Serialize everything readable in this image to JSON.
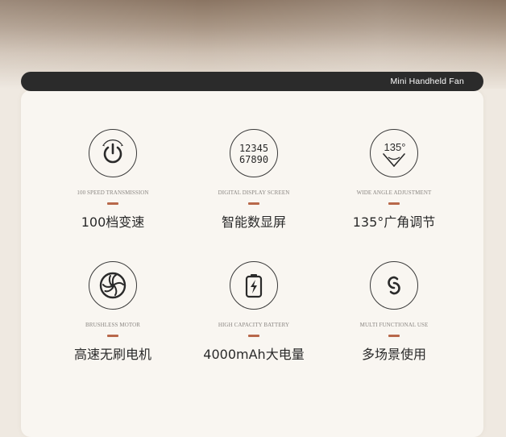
{
  "header": {
    "title": "Mini Handheld Fan"
  },
  "colors": {
    "header_bg": "#2b2b2b",
    "accent": "#b8684a",
    "card_bg": "#f9f6f1"
  },
  "features": [
    {
      "icon": "power-icon",
      "en": "100 SPEED TRANSMISSION",
      "cn": "100档变速"
    },
    {
      "icon": "digital-display-icon",
      "en": "DIGITAL DISPLAY SCREEN",
      "cn": "智能数显屏",
      "display_line1": "12345",
      "display_line2": "67890"
    },
    {
      "icon": "wide-angle-icon",
      "en": "WIDE ANGLE ADJUSTMENT",
      "cn": "135°广角调节",
      "angle_text": "135°"
    },
    {
      "icon": "fan-motor-icon",
      "en": "BRUSHLESS MOTOR",
      "cn": "高速无刷电机"
    },
    {
      "icon": "battery-icon",
      "en": "HIGH CAPACITY BATTERY",
      "cn": "4000mAh大电量"
    },
    {
      "icon": "multi-link-icon",
      "en": "MULTI FUNCTIONAL USE",
      "cn": "多场景使用"
    }
  ]
}
